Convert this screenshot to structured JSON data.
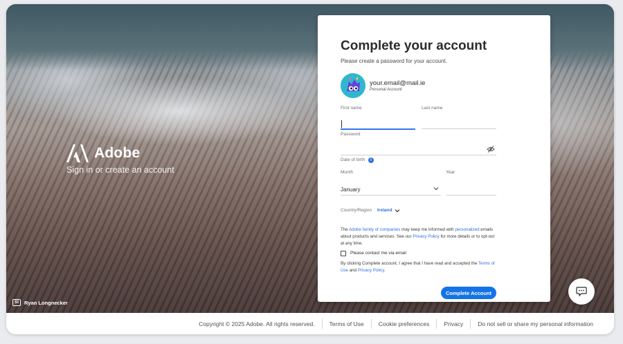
{
  "hero": {
    "brand_name": "Adobe",
    "tagline": "Sign in or create an account",
    "photo_credit_badge": "St",
    "photo_credit": "Ryan Longnecker"
  },
  "form": {
    "title": "Complete your account",
    "subtitle": "Please create a password for your account.",
    "account_email": "your.email@mail.ie",
    "account_type": "Personal Account",
    "first_name_label": "First name",
    "first_name_value": "",
    "last_name_label": "Last name",
    "last_name_value": "",
    "password_label": "Password",
    "password_value": "",
    "dob_label": "Date of birth",
    "dob_info_icon": "i",
    "month_label": "Month",
    "month_value": "January",
    "year_label": "Year",
    "year_value": "",
    "country_label": "Country/Region",
    "country_value": "Ireland",
    "consent": {
      "part1": "The ",
      "link_family": "Adobe family of companies",
      "part2": " may keep me informed with ",
      "link_personalized": "personalized",
      "part3": " emails about products and services. See our ",
      "link_privacy": "Privacy Policy",
      "part4": " for more details or to opt-out at any time."
    },
    "checkbox_label": "Please contact me via email",
    "checkbox_checked": false,
    "terms": {
      "part1": "By clicking Complete account, I agree that I have read and accepted the ",
      "link_terms": "Terms of Use",
      "part2": " and ",
      "link_privacy": "Privacy Policy",
      "part3": "."
    },
    "submit_label": "Complete Account"
  },
  "footer": {
    "copyright": "Copyright © 2025 Adobe. All rights reserved.",
    "terms": "Terms of Use",
    "cookies": "Cookie preferences",
    "privacy": "Privacy",
    "do_not_sell": "Do not sell or share my personal information"
  },
  "icons": {
    "brand_logo": "adobe-logo-icon",
    "password_toggle": "eye-slash-icon",
    "chevron": "chevron-down-icon",
    "chat": "chat-bubble-icon"
  },
  "colors": {
    "accent": "#1473e6",
    "link": "#2f6fe0",
    "avatar_bg": "#2fb7cf"
  }
}
